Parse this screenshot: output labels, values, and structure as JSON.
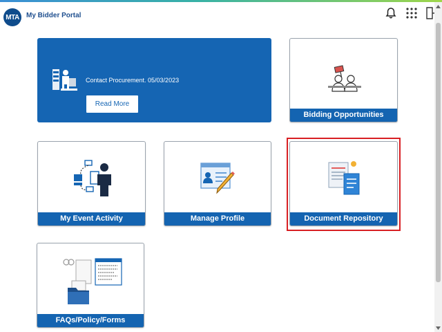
{
  "header": {
    "logo_text": "MTA",
    "app_title": "My Bidder Portal",
    "icons": [
      "bell-icon",
      "apps-grid-icon",
      "logout-icon"
    ]
  },
  "announcement": {
    "text": "Contact Procurement. 05/03/2023",
    "button_label": "Read More"
  },
  "tiles": {
    "bidding": {
      "label": "Bidding Opportunities",
      "icon": "bidding-people-icon"
    },
    "event_activity": {
      "label": "My Event Activity",
      "icon": "event-workflow-icon"
    },
    "manage_profile": {
      "label": "Manage Profile",
      "icon": "profile-card-pencil-icon"
    },
    "document_repository": {
      "label": "Document Repository",
      "icon": "document-stack-icon"
    },
    "faqs": {
      "label": "FAQs/Policy/Forms",
      "icon": "folder-documents-icon"
    }
  },
  "colors": {
    "brand_blue": "#1565b3",
    "highlight_red": "#d81e22",
    "title_blue": "#1f4f8f"
  }
}
